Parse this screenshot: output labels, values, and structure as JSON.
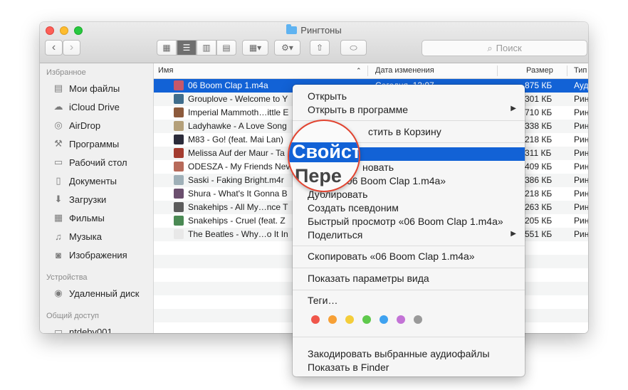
{
  "window": {
    "title": "Рингтоны",
    "search_placeholder": "Поиск",
    "nav_back": "‹",
    "nav_forward": "›"
  },
  "sidebar": {
    "favorites_title": "Избранное",
    "favorites": [
      {
        "label": "Мои файлы",
        "icon": "all-files-icon",
        "glyph": "▤"
      },
      {
        "label": "iCloud Drive",
        "icon": "cloud-icon",
        "glyph": "☁"
      },
      {
        "label": "AirDrop",
        "icon": "airdrop-icon",
        "glyph": "◎"
      },
      {
        "label": "Программы",
        "icon": "applications-icon",
        "glyph": "⚒"
      },
      {
        "label": "Рабочий стол",
        "icon": "desktop-icon",
        "glyph": "▭"
      },
      {
        "label": "Документы",
        "icon": "documents-icon",
        "glyph": "▯"
      },
      {
        "label": "Загрузки",
        "icon": "downloads-icon",
        "glyph": "⬇"
      },
      {
        "label": "Фильмы",
        "icon": "movies-icon",
        "glyph": "▦"
      },
      {
        "label": "Музыка",
        "icon": "music-icon",
        "glyph": "♫"
      },
      {
        "label": "Изображения",
        "icon": "pictures-icon",
        "glyph": "◙"
      }
    ],
    "devices_title": "Устройства",
    "devices": [
      {
        "label": "Удаленный диск",
        "icon": "remote-disk-icon",
        "glyph": "◉"
      }
    ],
    "shared_title": "Общий доступ",
    "shared": [
      {
        "label": "ntdebv001",
        "icon": "network-computer-icon",
        "glyph": "▭"
      }
    ]
  },
  "columns": {
    "name": "Имя",
    "date": "Дата изменения",
    "size": "Размер",
    "kind": "Тип"
  },
  "files": [
    {
      "name": "06 Boom Clap 1.m4a",
      "date": "Сегодня, 13:07",
      "size": "875 КБ",
      "kind": "Ауд",
      "selected": true,
      "color": "#c7586a"
    },
    {
      "name": "Grouplove - Welcome to Y",
      "date": "",
      "size": "301 КБ",
      "kind": "Рин",
      "selected": false,
      "color": "#3f6d8c"
    },
    {
      "name": "Imperial Mammoth…ittle E",
      "date": "",
      "size": "710 КБ",
      "kind": "Рин",
      "selected": false,
      "color": "#8c5a3c"
    },
    {
      "name": "Ladyhawke - A Love Song",
      "date": "",
      "size": "338 КБ",
      "kind": "Рин",
      "selected": false,
      "color": "#b4a07a"
    },
    {
      "name": "M83 - Go! (feat. Mai Lan)",
      "date": "",
      "size": "218 КБ",
      "kind": "Рин",
      "selected": false,
      "color": "#2b2b3a"
    },
    {
      "name": "Melissa Auf der Maur - Ta",
      "date": "",
      "size": "311 КБ",
      "kind": "Рин",
      "selected": false,
      "color": "#a33b2f"
    },
    {
      "name": "ODESZA - My Friends Nev",
      "date": "",
      "size": "409 КБ",
      "kind": "Рин",
      "selected": false,
      "color": "#b76a5a"
    },
    {
      "name": "Saski - Faking Bright.m4r",
      "date": "",
      "size": "386 КБ",
      "kind": "Рин",
      "selected": false,
      "color": "#9fb0b8"
    },
    {
      "name": "Shura - What's It Gonna B",
      "date": "",
      "size": "218 КБ",
      "kind": "Рин",
      "selected": false,
      "color": "#6b4f6e"
    },
    {
      "name": "Snakehips - All My…nce T",
      "date": "",
      "size": "263 КБ",
      "kind": "Рин",
      "selected": false,
      "color": "#5c5c5c"
    },
    {
      "name": "Snakehips - Cruel (feat. Z",
      "date": "",
      "size": "205 КБ",
      "kind": "Рин",
      "selected": false,
      "color": "#4b8a54"
    },
    {
      "name": "The Beatles - Why…o It In",
      "date": "",
      "size": "551 КБ",
      "kind": "Рин",
      "selected": false,
      "color": "#e8e8e8"
    }
  ],
  "context_menu": {
    "items": [
      {
        "label": "Открыть",
        "submenu": false
      },
      {
        "label": "Открыть в программе",
        "submenu": true
      },
      {
        "label": "Переместить в Корзину",
        "submenu": false
      },
      {
        "label": "Свойства",
        "submenu": false,
        "highlighted": true
      },
      {
        "label": "Переименовать",
        "submenu": false
      },
      {
        "label": "Переименовать «06 Boom Clap 1.m4a»",
        "submenu": false
      },
      {
        "label": "Дублировать",
        "submenu": false
      },
      {
        "label": "Создать псевдоним",
        "submenu": false
      },
      {
        "label": "Быстрый просмотр «06 Boom Clap 1.m4a»",
        "submenu": false
      },
      {
        "label": "Поделиться",
        "submenu": true
      },
      {
        "label": "Скопировать «06 Boom Clap 1.m4a»",
        "submenu": false
      },
      {
        "label": "Показать параметры вида",
        "submenu": false
      },
      {
        "label": "Теги…",
        "submenu": false
      },
      {
        "label": "Закодировать выбранные аудиофайлы",
        "submenu": false
      },
      {
        "label": "Показать в Finder",
        "submenu": false
      }
    ],
    "visible_fragments": {
      "move_to_trash": "стить в Корзину",
      "rename": "новать"
    },
    "tag_colors": [
      "#f0564b",
      "#f7a035",
      "#f4cd3a",
      "#5fc94c",
      "#3fa2f0",
      "#c373d6",
      "#9a9a9a"
    ]
  },
  "magnifier": {
    "text_highlighted": "Свойст",
    "text_below": "Пере"
  }
}
